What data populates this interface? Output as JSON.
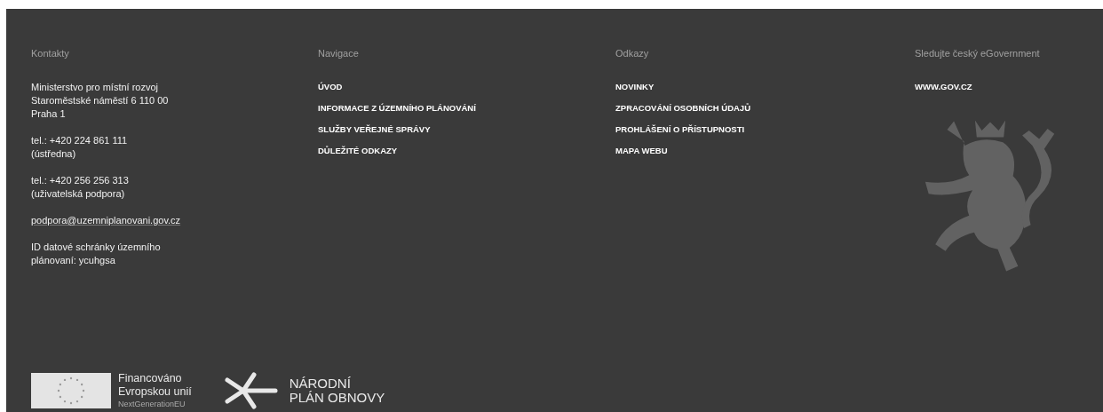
{
  "contacts": {
    "heading": "Kontakty",
    "blocks": [
      {
        "kind": "text",
        "lines": [
          "Ministerstvo pro místní rozvoj",
          "Staroměstské náměstí 6 110 00",
          "Praha 1"
        ]
      },
      {
        "kind": "text",
        "lines": [
          "tel.: +420 224 861 111",
          "(ústředna)"
        ]
      },
      {
        "kind": "text",
        "lines": [
          "tel.: +420 256 256 313",
          "(uživatelská podpora)"
        ]
      },
      {
        "kind": "link",
        "lines": [
          "podpora@uzemniplanovani.gov.cz"
        ]
      },
      {
        "kind": "text",
        "lines": [
          "ID datové schránky územního",
          "plánovaní: ycuhgsa"
        ]
      }
    ]
  },
  "navigation": {
    "heading": "Navigace",
    "links": [
      "ÚVOD",
      "INFORMACE Z ÚZEMNÍHO PLÁNOVÁNÍ",
      "SLUŽBY VEŘEJNÉ SPRÁVY",
      "DŮLEŽITÉ ODKAZY"
    ]
  },
  "references": {
    "heading": "Odkazy",
    "links": [
      "NOVINKY",
      "ZPRACOVÁNÍ OSOBNÍCH ÚDAJŮ",
      "PROHLÁŠENÍ O PŘÍSTUPNOSTI",
      "MAPA WEBU"
    ]
  },
  "egovernment": {
    "heading": "Sledujte český eGovernment",
    "links": [
      "WWW.GOV.CZ"
    ]
  },
  "logos": {
    "eu": {
      "lines": [
        "Financováno",
        "Evropskou unií"
      ],
      "note": "NextGenerationEU"
    },
    "npo": {
      "lines": [
        "NÁRODNÍ",
        "PLÁN OBNOVY"
      ]
    }
  }
}
